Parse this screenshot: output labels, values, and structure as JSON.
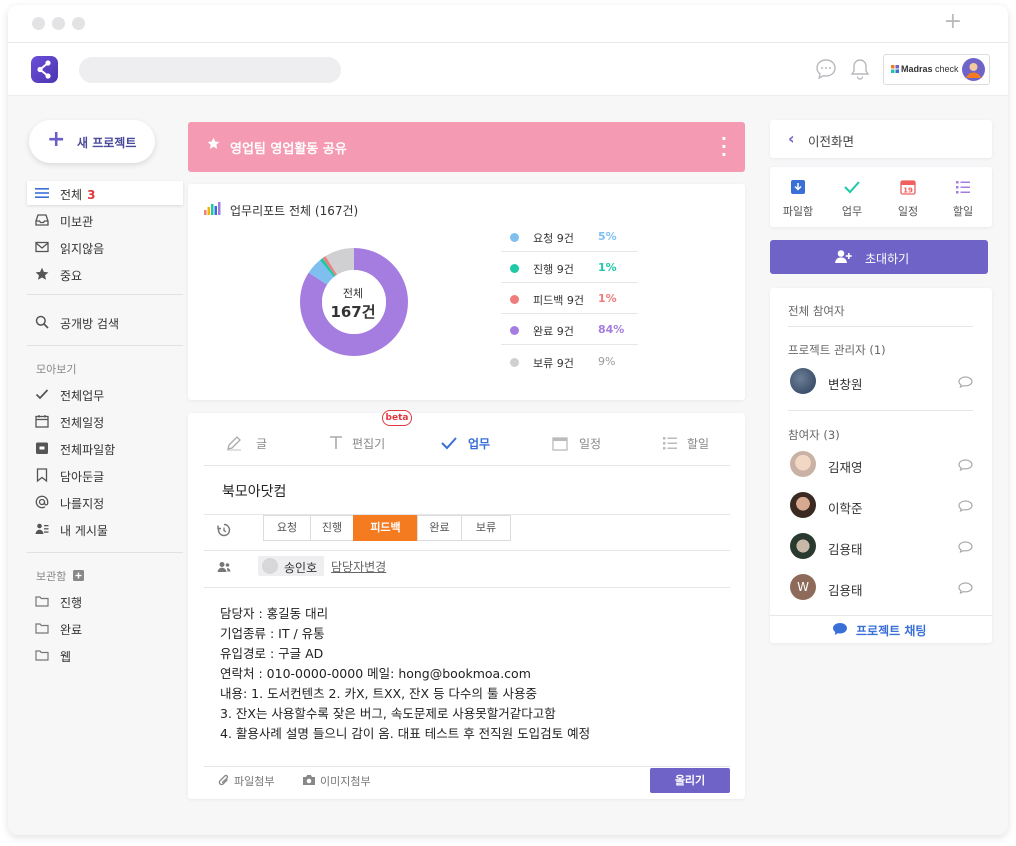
{
  "app": {
    "brand_name": "Madras",
    "brand_suffix": "check"
  },
  "sidebar": {
    "new_project_label": "새 프로젝트",
    "main_items": [
      {
        "label": "전체",
        "count": "3"
      },
      {
        "label": "미보관"
      },
      {
        "label": "읽지않음"
      },
      {
        "label": "중요"
      }
    ],
    "search_label": "공개방 검색",
    "collect_heading": "모아보기",
    "collect_items": [
      {
        "label": "전체업무"
      },
      {
        "label": "전체일정"
      },
      {
        "label": "전체파일함"
      },
      {
        "label": "담아둔글"
      },
      {
        "label": "나를지정"
      },
      {
        "label": "내 게시물"
      }
    ],
    "archive_heading": "보관함",
    "archive_items": [
      {
        "label": "진행"
      },
      {
        "label": "완료"
      },
      {
        "label": "웹"
      }
    ]
  },
  "banner": {
    "title": "영업팀 영업활동 공유"
  },
  "report": {
    "title": "업무리포트 전체 (167건)",
    "center_label": "전체",
    "center_value": "167건"
  },
  "chart_data": {
    "type": "pie",
    "title": "업무리포트 전체 (167건)",
    "categories": [
      "요청 9건",
      "진행 9건",
      "피드백 9건",
      "완료 9건",
      "보류 9건"
    ],
    "values": [
      5,
      1,
      1,
      84,
      9
    ],
    "labels": [
      "5%",
      "1%",
      "1%",
      "84%",
      "9%"
    ],
    "colors": [
      "#7fbff0",
      "#1ec9a8",
      "#ef7d7d",
      "#a57de0",
      "#d0d0d2"
    ],
    "legend": "right"
  },
  "compose": {
    "tabs": [
      {
        "label": "글"
      },
      {
        "label": "편집기"
      },
      {
        "label": "업무"
      },
      {
        "label": "일정"
      },
      {
        "label": "할일"
      }
    ],
    "beta_badge": "beta",
    "title": "북모아닷컴",
    "statuses": [
      "요청",
      "진행",
      "피드백",
      "완료",
      "보류"
    ],
    "active_status": "피드백",
    "assignee": "송인호",
    "change_assignee": "담당자변경",
    "body": [
      "담당자 : 홍길동 대리",
      "기업종류 : IT / 유통",
      "유입경로 : 구글 AD",
      "연락처 : 010-0000-0000    메일: hong@bookmoa.com",
      "내용: 1. 도서컨텐츠  2. 카X, 트XX, 잔X 등 다수의 툴 사용중",
      "3. 잔X는 사용할수록 잦은 버그, 속도문제로 사용못할거같다고함",
      "4. 활용사례 설명 들으니 감이 옴. 대표 테스트 후 전직원 도입검토 예정"
    ],
    "attach_file": "파일첨부",
    "attach_image": "이미지첨부",
    "submit": "올리기"
  },
  "right": {
    "back_label": "이전화면",
    "tools": [
      {
        "label": "파일함"
      },
      {
        "label": "업무"
      },
      {
        "label": "일정"
      },
      {
        "label": "할일"
      }
    ],
    "invite_label": "초대하기",
    "all_participants": "전체 참여자",
    "admin_heading": "프로젝트 관리자 (1)",
    "admins": [
      {
        "name": "변창원"
      }
    ],
    "member_heading": "참여자 (3)",
    "members": [
      {
        "name": "김재영"
      },
      {
        "name": "이학준"
      },
      {
        "name": "김용태"
      },
      {
        "name": "김용태",
        "initial": "W"
      }
    ],
    "chat_label": "프로젝트 채팅"
  }
}
